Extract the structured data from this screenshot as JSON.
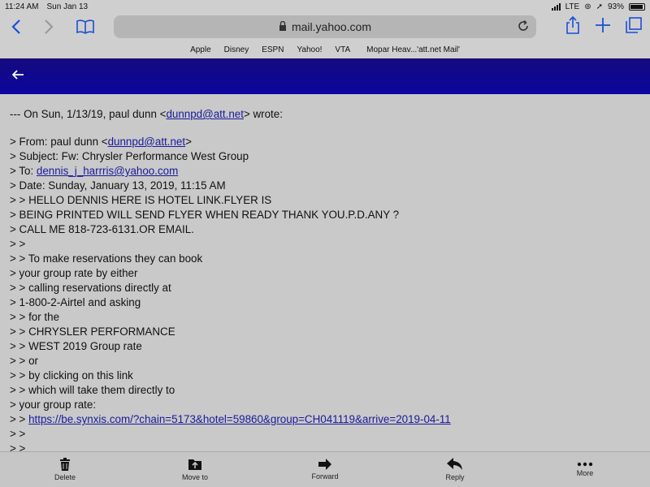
{
  "status": {
    "time": "11:24 AM",
    "date": "Sun Jan 13",
    "network": "LTE",
    "battery": "93%",
    "battery_level": 0.93
  },
  "toolbar": {
    "url": "mail.yahoo.com"
  },
  "bookmarks": [
    "Apple",
    "Disney",
    "ESPN",
    "Yahoo!",
    "VTA",
    "Mopar Heav...'att.net Mail'"
  ],
  "email": {
    "intro_prefix": "--- On Sun, 1/13/19, paul dunn <",
    "intro_email": "dunnpd@att.net",
    "intro_suffix": "> wrote:",
    "from_prefix": "> From: paul dunn <",
    "from_email": "dunnpd@att.net",
    "from_suffix": ">",
    "subject": "> Subject: Fw: Chrysler Performance West Group",
    "to_prefix": "> To: ",
    "to_email": "dennis_j_harrris@yahoo.com",
    "date": "> Date: Sunday, January 13, 2019, 11:15 AM",
    "lines": [
      "> > HELLO DENNIS HERE IS HOTEL LINK.FLYER IS",
      "> BEING PRINTED WILL SEND FLYER WHEN READY THANK YOU.P.D.ANY ?",
      "> CALL ME 818-723-6131.OR EMAIL.",
      "> >",
      "> > To make reservations they can book",
      "> your group rate by either",
      "> > calling reservations directly at",
      "> 1-800-2-Airtel and asking",
      "> > for the",
      "> > CHRYSLER PERFORMANCE",
      "> > WEST 2019 Group rate",
      "> > or",
      "> > by clicking on this link",
      "> > which will take them directly to",
      "> your group rate:"
    ],
    "link_prefix": "> > ",
    "link_url": "https://be.synxis.com/?chain=5173&hotel=59860&group=CH041119&arrive=2019-04-11",
    "tail_lines": [
      "> >",
      "> >"
    ]
  },
  "bottom_bar": {
    "delete": "Delete",
    "move_to": "Move to",
    "forward": "Forward",
    "reply": "Reply",
    "more": "More"
  }
}
